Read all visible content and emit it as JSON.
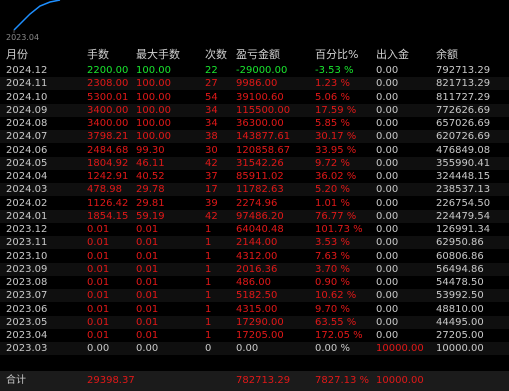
{
  "chart": {
    "date_label": "2023.04",
    "line_color": "#1e8fff"
  },
  "colors": {
    "positive": "#19e62e",
    "negative": "#e01818",
    "neutral": "#c8c8c8"
  },
  "headers": [
    "月份",
    "手数",
    "最大手数",
    "次数",
    "盈亏金额",
    "百分比%",
    "出入金",
    "余额"
  ],
  "rows": [
    {
      "month": "2024.12",
      "lots": "2200.00",
      "max": "100.00",
      "count": "22",
      "pnl": "-29000.00",
      "pct": "-3.53 %",
      "io": "0.00",
      "bal": "792713.29",
      "tone": "green"
    },
    {
      "month": "2024.11",
      "lots": "2308.00",
      "max": "100.00",
      "count": "27",
      "pnl": "9986.00",
      "pct": "1.23 %",
      "io": "0.00",
      "bal": "821713.29",
      "tone": "red"
    },
    {
      "month": "2024.10",
      "lots": "5300.01",
      "max": "100.00",
      "count": "54",
      "pnl": "39100.60",
      "pct": "5.06 %",
      "io": "0.00",
      "bal": "811727.29",
      "tone": "red"
    },
    {
      "month": "2024.09",
      "lots": "3400.00",
      "max": "100.00",
      "count": "34",
      "pnl": "115500.00",
      "pct": "17.59 %",
      "io": "0.00",
      "bal": "772626.69",
      "tone": "red"
    },
    {
      "month": "2024.08",
      "lots": "3400.00",
      "max": "100.00",
      "count": "34",
      "pnl": "36300.00",
      "pct": "5.85 %",
      "io": "0.00",
      "bal": "657026.69",
      "tone": "red"
    },
    {
      "month": "2024.07",
      "lots": "3798.21",
      "max": "100.00",
      "count": "38",
      "pnl": "143877.61",
      "pct": "30.17 %",
      "io": "0.00",
      "bal": "620726.69",
      "tone": "red"
    },
    {
      "month": "2024.06",
      "lots": "2484.68",
      "max": "99.30",
      "count": "30",
      "pnl": "120858.67",
      "pct": "33.95 %",
      "io": "0.00",
      "bal": "476849.08",
      "tone": "red"
    },
    {
      "month": "2024.05",
      "lots": "1804.92",
      "max": "46.11",
      "count": "42",
      "pnl": "31542.26",
      "pct": "9.72 %",
      "io": "0.00",
      "bal": "355990.41",
      "tone": "red"
    },
    {
      "month": "2024.04",
      "lots": "1242.91",
      "max": "40.52",
      "count": "37",
      "pnl": "85911.02",
      "pct": "36.02 %",
      "io": "0.00",
      "bal": "324448.15",
      "tone": "red"
    },
    {
      "month": "2024.03",
      "lots": "478.98",
      "max": "29.78",
      "count": "17",
      "pnl": "11782.63",
      "pct": "5.20 %",
      "io": "0.00",
      "bal": "238537.13",
      "tone": "red"
    },
    {
      "month": "2024.02",
      "lots": "1126.42",
      "max": "29.81",
      "count": "39",
      "pnl": "2274.96",
      "pct": "1.01 %",
      "io": "0.00",
      "bal": "226754.50",
      "tone": "red"
    },
    {
      "month": "2024.01",
      "lots": "1854.15",
      "max": "59.19",
      "count": "42",
      "pnl": "97486.20",
      "pct": "76.77 %",
      "io": "0.00",
      "bal": "224479.54",
      "tone": "red"
    },
    {
      "month": "2023.12",
      "lots": "0.01",
      "max": "0.01",
      "count": "1",
      "pnl": "64040.48",
      "pct": "101.73 %",
      "io": "0.00",
      "bal": "126991.34",
      "tone": "red"
    },
    {
      "month": "2023.11",
      "lots": "0.01",
      "max": "0.01",
      "count": "1",
      "pnl": "2144.00",
      "pct": "3.53 %",
      "io": "0.00",
      "bal": "62950.86",
      "tone": "red"
    },
    {
      "month": "2023.10",
      "lots": "0.01",
      "max": "0.01",
      "count": "1",
      "pnl": "4312.00",
      "pct": "7.63 %",
      "io": "0.00",
      "bal": "60806.86",
      "tone": "red"
    },
    {
      "month": "2023.09",
      "lots": "0.01",
      "max": "0.01",
      "count": "1",
      "pnl": "2016.36",
      "pct": "3.70 %",
      "io": "0.00",
      "bal": "56494.86",
      "tone": "red"
    },
    {
      "month": "2023.08",
      "lots": "0.01",
      "max": "0.01",
      "count": "1",
      "pnl": "486.00",
      "pct": "0.90 %",
      "io": "0.00",
      "bal": "54478.50",
      "tone": "red"
    },
    {
      "month": "2023.07",
      "lots": "0.01",
      "max": "0.01",
      "count": "1",
      "pnl": "5182.50",
      "pct": "10.62 %",
      "io": "0.00",
      "bal": "53992.50",
      "tone": "red"
    },
    {
      "month": "2023.06",
      "lots": "0.01",
      "max": "0.01",
      "count": "1",
      "pnl": "4315.00",
      "pct": "9.70 %",
      "io": "0.00",
      "bal": "48810.00",
      "tone": "red"
    },
    {
      "month": "2023.05",
      "lots": "0.01",
      "max": "0.01",
      "count": "1",
      "pnl": "17290.00",
      "pct": "63.55 %",
      "io": "0.00",
      "bal": "44495.00",
      "tone": "red"
    },
    {
      "month": "2023.04",
      "lots": "0.01",
      "max": "0.01",
      "count": "1",
      "pnl": "17205.00",
      "pct": "172.05 %",
      "io": "0.00",
      "bal": "27205.00",
      "tone": "red"
    },
    {
      "month": "2023.03",
      "lots": "0.00",
      "max": "0.00",
      "count": "0",
      "pnl": "0.00",
      "pct": "0.00 %",
      "io": "10000.00",
      "bal": "10000.00",
      "tone": "gray",
      "io_tone": "red"
    }
  ],
  "total": {
    "label": "合计",
    "lots": "29398.37",
    "pnl": "782713.29",
    "pct": "7827.13 %",
    "io": "10000.00"
  }
}
